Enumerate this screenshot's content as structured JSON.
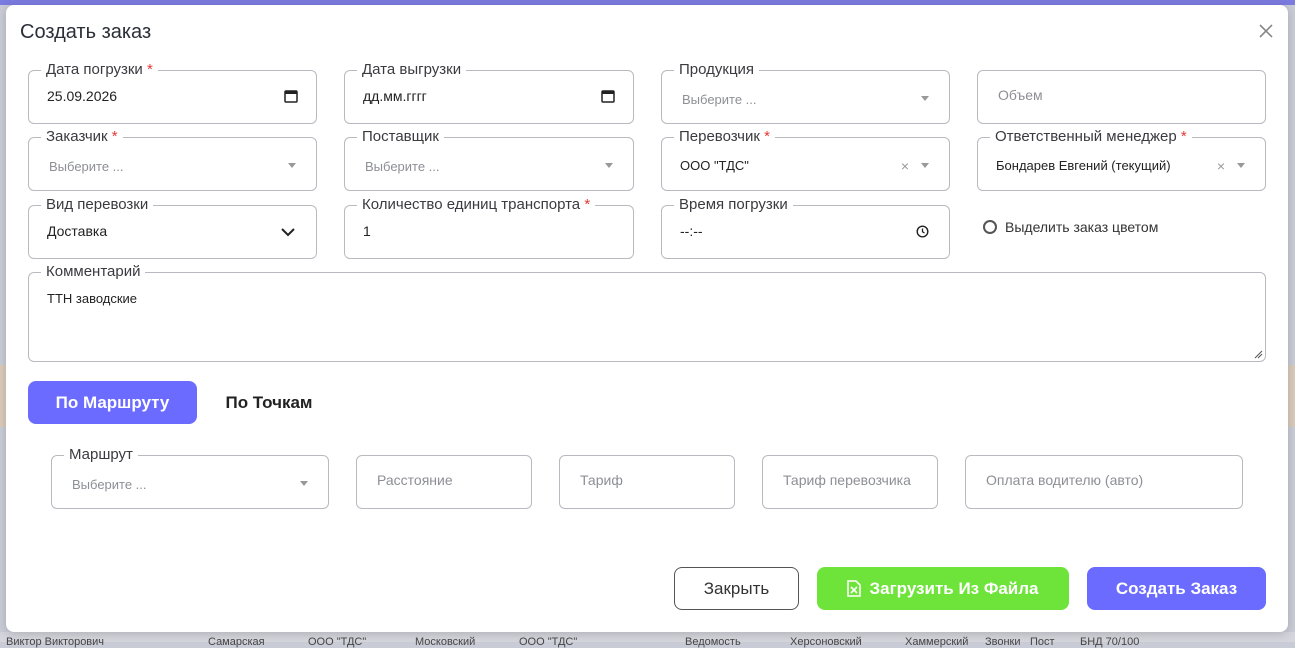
{
  "background": {
    "bottom_text": [
      "Виктор Викторович",
      "Самарская",
      "ООО \"ТДС\"",
      "Московский",
      "ООО \"ТДС\"",
      "Ведомость",
      "Херсоновский",
      "Хаммерский",
      "Звонки",
      "Пост",
      "БНД 70/100"
    ]
  },
  "modal": {
    "title": "Создать заказ",
    "fields": {
      "load_date": {
        "label": "Дата погрузки",
        "required": "*",
        "value": "25.09.2026"
      },
      "unload_date": {
        "label": "Дата выгрузки",
        "value": "дд.мм.гггг"
      },
      "product": {
        "label": "Продукция",
        "placeholder": "Выберите ..."
      },
      "volume": {
        "placeholder": "Объем"
      },
      "customer": {
        "label": "Заказчик",
        "required": "*",
        "placeholder": "Выберите ..."
      },
      "supplier": {
        "label": "Поставщик",
        "placeholder": "Выберите ..."
      },
      "carrier": {
        "label": "Перевозчик",
        "required": "*",
        "value": "ООО \"ТДС\"",
        "clear": "×"
      },
      "manager": {
        "label": "Ответственный менеджер",
        "required": "*",
        "value": "Бондарев Евгений (текущий)",
        "clear": "×"
      },
      "transport_type": {
        "label": "Вид перевозки",
        "value": "Доставка"
      },
      "transport_units": {
        "label": "Количество единиц транспорта",
        "required": "*",
        "value": "1"
      },
      "load_time": {
        "label": "Время погрузки",
        "value": "--:--"
      },
      "highlight_color": {
        "label": "Выделить заказ цветом"
      },
      "comment": {
        "label": "Комментарий",
        "value": "ТТН заводские"
      }
    },
    "tabs": {
      "route": "По Маршруту",
      "points": "По Точкам"
    },
    "route_fields": {
      "route": {
        "label": "Маршрут",
        "placeholder": "Выберите ..."
      },
      "distance": {
        "placeholder": "Расстояние"
      },
      "tariff": {
        "placeholder": "Тариф"
      },
      "carrier_tariff": {
        "placeholder": "Тариф перевозчика"
      },
      "driver_payment": {
        "placeholder": "Оплата водителю (авто)"
      }
    },
    "buttons": {
      "close": "Закрыть",
      "upload": "Загрузить Из Файла",
      "create": "Создать Заказ"
    },
    "colors": {
      "accent": "#6b6bff",
      "upload": "#6ee33a",
      "required": "#e53935"
    },
    "icons": {
      "close": "close-icon",
      "calendar": "calendar-icon",
      "clock": "clock-icon",
      "chevron": "chevron-down-icon",
      "excel": "excel-file-icon"
    }
  }
}
